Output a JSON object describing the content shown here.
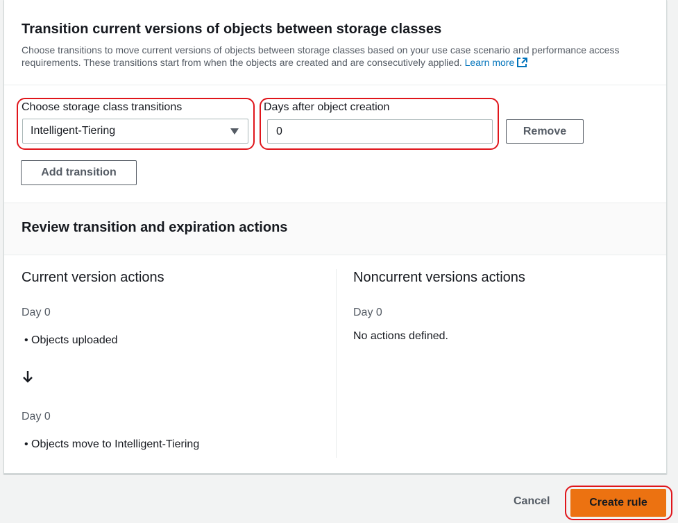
{
  "transitions_section": {
    "title": "Transition current versions of objects between storage classes",
    "description": "Choose transitions to move current versions of objects between storage classes based on your use case scenario and performance access requirements. These transitions start from when the objects are created and are consecutively applied.",
    "learn_more": "Learn more",
    "storage_class_label": "Choose storage class transitions",
    "storage_class_value": "Intelligent-Tiering",
    "days_label": "Days after object creation",
    "days_value": "0",
    "remove_label": "Remove",
    "add_transition_label": "Add transition"
  },
  "review_section": {
    "title": "Review transition and expiration actions",
    "current": {
      "title": "Current version actions",
      "day1": "Day 0",
      "item1": "Objects uploaded",
      "arrow": "↓",
      "day2": "Day 0",
      "item2": "Objects move to Intelligent-Tiering"
    },
    "noncurrent": {
      "title": "Noncurrent versions actions",
      "day1": "Day 0",
      "text": "No actions defined."
    }
  },
  "footer": {
    "cancel_label": "Cancel",
    "create_label": "Create rule"
  },
  "colors": {
    "primary_button": "#ec7211",
    "link": "#0073bb",
    "highlight": "#e0151b"
  },
  "icons": {
    "external_link": "external-link-icon",
    "caret": "caret-down-icon",
    "arrow": "arrow-down-icon"
  }
}
